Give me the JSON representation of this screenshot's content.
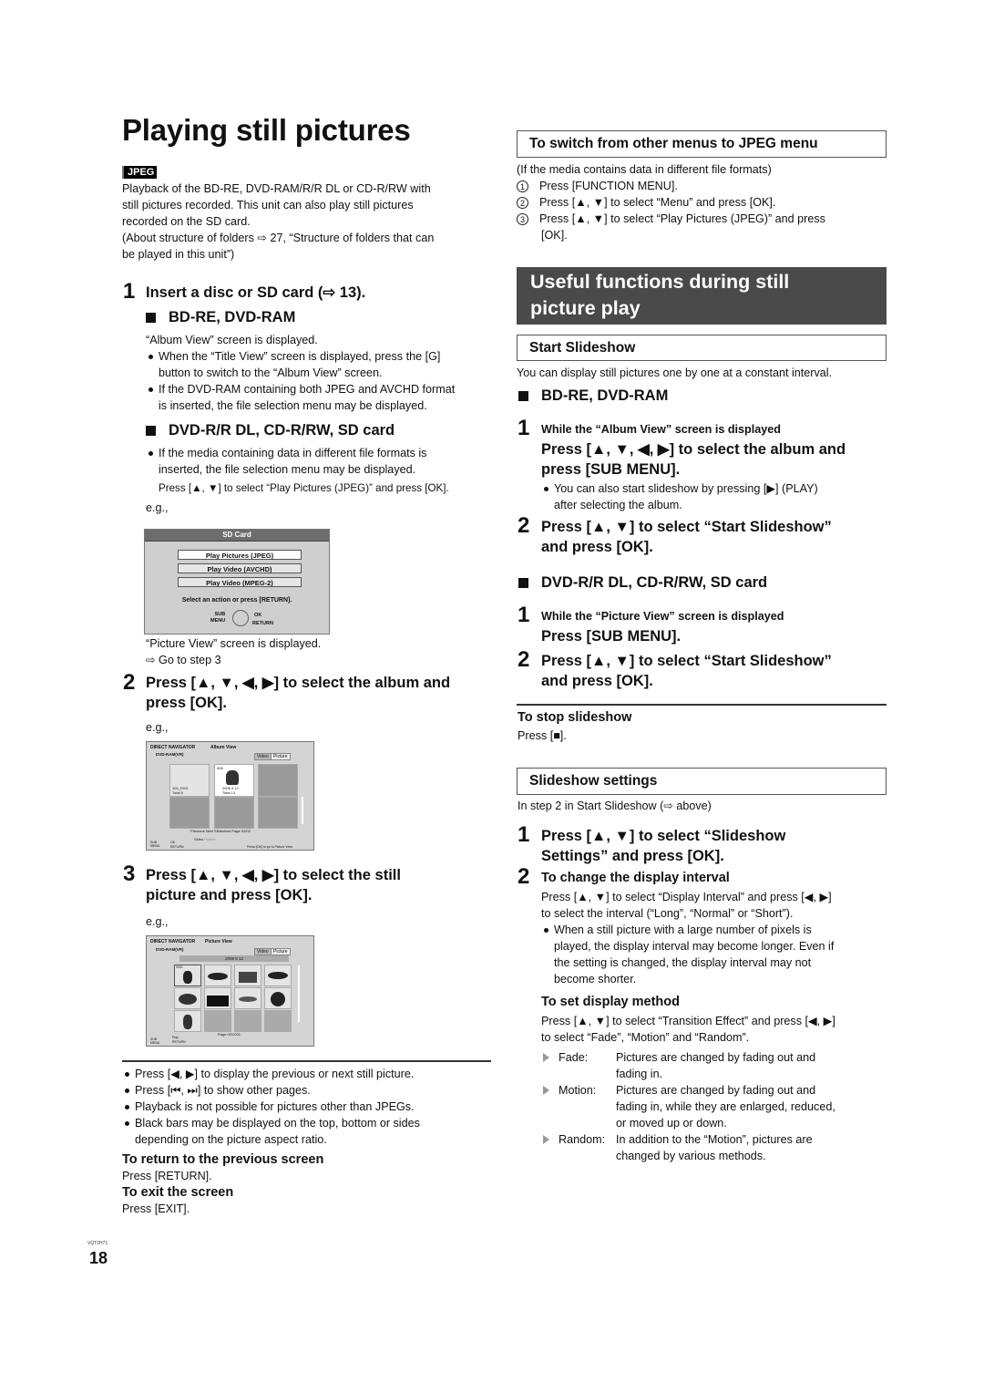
{
  "page": {
    "title": "Playing still pictures",
    "badge": "JPEG",
    "page_number": "18",
    "doc_code": "VQT2H71"
  },
  "intro": {
    "lines": [
      "Playback of the BD-RE, DVD-RAM/R/R DL or CD-R/RW with",
      "still pictures recorded. This unit can also play still pictures",
      "recorded on the SD card.",
      "(About structure of folders ⇨ 27, “Structure of folders that can",
      "be played in this unit”)"
    ]
  },
  "left_steps": {
    "step1": {
      "num": "1",
      "text": "Insert a disc or SD card (⇨ 13).",
      "bdre_head": "BD-RE, DVD-RAM",
      "bdre_note": "“Album View” screen is displayed.",
      "bdre_bullets": [
        [
          "When the “Title View” screen is displayed, press the [G]",
          "button to switch to the “Album View” screen."
        ],
        [
          "If the DVD-RAM containing both JPEG and AVCHD format",
          "is inserted, the file selection menu may be displayed."
        ]
      ],
      "dvdr_head": "DVD-R/R DL, CD-R/RW, SD card",
      "dvdr_bullet": [
        "If the media containing data in different file formats is",
        "inserted, the file selection menu may be displayed."
      ],
      "dvdr_press": "Press [▲, ▼] to select “Play Pictures (JPEG)” and press [OK].",
      "eg": "e.g.,",
      "after1": "“Picture View” screen is displayed.",
      "after2": "⇨ Go to step 3"
    },
    "step2": {
      "num": "2",
      "lines": [
        "Press [▲, ▼, ◀, ▶] to select the album and",
        "press [OK]."
      ],
      "eg": "e.g.,"
    },
    "step3": {
      "num": "3",
      "lines": [
        "Press [▲, ▼, ◀, ▶] to select the still",
        "picture and press [OK]."
      ],
      "eg": "e.g.,"
    }
  },
  "sd_menu": {
    "header": "SD Card",
    "options": [
      "Play Pictures (JPEG)",
      "Play Video (AVCHD)",
      "Play Video (MPEG-2)"
    ],
    "selected_index": 0,
    "prompt": "Select an action or press [RETURN].",
    "sub": "SUB",
    "menu": "MENU",
    "ok": "OK",
    "return": "RETURN"
  },
  "album_view": {
    "nav": "DIRECT NAVIGATOR",
    "view": "Album View",
    "drive": "DVD-RAM(VR)",
    "tabs": [
      "Video",
      "Picture"
    ],
    "albums": [
      {
        "name": "100_DVD",
        "total": "Total 8"
      },
      {
        "date": "2006 9 12",
        "total": "Total 13",
        "num": "008"
      }
    ],
    "controls": [
      "Previous",
      "Next",
      "Slideshow",
      "Page 02/02"
    ],
    "buttons": [
      "Video",
      "Picture"
    ],
    "footer_left_sub": "SUB",
    "footer_left_menu": "MENU",
    "ok": "OK",
    "return": "RETURN",
    "hint": "Press [OK] to go to Picture View"
  },
  "picture_view": {
    "nav": "DIRECT NAVIGATOR",
    "view": "Picture View",
    "drive": "DVD-RAM(VR)",
    "tabs": [
      "Video",
      "Picture"
    ],
    "date": "2006  9  12",
    "first_num": "0001",
    "page": "Page 001/001",
    "sub": "SUB",
    "menu": "MENU",
    "play": "Play",
    "return": "RETURN"
  },
  "left_notes": {
    "bullets": [
      "Press [◀, ▶] to display the previous or next still picture.",
      "Press [⏮, ⏭] to show other pages.",
      "Playback is not possible for pictures other than JPEGs.",
      "Black bars may be displayed on the top, bottom or sides"
    ],
    "bullet4_cont": "depending on the picture aspect ratio.",
    "return_head": "To return to the previous screen",
    "return_text": "Press [RETURN].",
    "exit_head": "To exit the screen",
    "exit_text": "Press [EXIT]."
  },
  "switch_menu": {
    "heading": "To switch from other menus to JPEG menu",
    "note": "(If the media contains data in different file formats)",
    "items": [
      {
        "mark": "1",
        "text": "Press [FUNCTION MENU]."
      },
      {
        "mark": "2",
        "text": "Press [▲, ▼] to select “Menu” and press [OK]."
      },
      {
        "mark": "3",
        "text": "Press [▲, ▼] to select “Play Pictures (JPEG)” and press"
      }
    ],
    "item3_cont": "[OK]."
  },
  "useful": {
    "banner_line1": "Useful functions during still",
    "banner_line2": "picture play"
  },
  "start_slideshow": {
    "heading": "Start Slideshow",
    "intro": "You can display still pictures one by one at a constant interval.",
    "bdre_head": "BD-RE, DVD-RAM",
    "bd_step1_num": "1",
    "bd_step1_cond": "While the “Album View” screen is displayed",
    "bd_step1_lines": [
      "Press [▲, ▼, ◀, ▶] to select the album and",
      "press [SUB MENU]."
    ],
    "bd_step1_bullet": [
      "You can also start slideshow by pressing [▶] (PLAY)",
      "after selecting the album."
    ],
    "bd_step2_num": "2",
    "bd_step2_lines": [
      "Press [▲, ▼] to select “Start Slideshow”",
      "and press [OK]."
    ],
    "dvdr_head": "DVD-R/R DL, CD-R/RW, SD card",
    "dv_step1_num": "1",
    "dv_step1_cond": "While the “Picture View” screen is displayed",
    "dv_step1_line": "Press [SUB MENU].",
    "dv_step2_num": "2",
    "dv_step2_lines": [
      "Press [▲, ▼] to select “Start Slideshow”",
      "and press [OK]."
    ],
    "stop_head": "To stop slideshow",
    "stop_text": "Press [■]."
  },
  "slideshow_settings": {
    "heading": "Slideshow settings",
    "intro": "In step 2 in Start Slideshow (⇨ above)",
    "step1_num": "1",
    "step1_lines": [
      "Press [▲, ▼] to select “Slideshow",
      "Settings” and press [OK]."
    ],
    "step2_num": "2",
    "interval_head": "To change the display interval",
    "interval_lines": [
      "Press [▲, ▼] to select “Display Interval” and press [◀, ▶]",
      "to select the interval (“Long”, “Normal” or “Short”)."
    ],
    "interval_bullet": [
      "When a still picture with a large number of pixels is",
      "played, the display interval may become longer. Even if",
      "the setting is changed, the display interval may not",
      "become shorter."
    ],
    "method_head": "To set display method",
    "method_lines": [
      "Press [▲, ▼] to select “Transition Effect” and press [◀, ▶]",
      "to select “Fade”, “Motion” and “Random”."
    ],
    "effects": [
      {
        "name": "Fade:",
        "lines": [
          "Pictures are changed by fading out and",
          "fading in."
        ]
      },
      {
        "name": "Motion:",
        "lines": [
          "Pictures are changed by fading out and",
          "fading in, while they are enlarged, reduced,",
          "or moved up or down."
        ]
      },
      {
        "name": "Random:",
        "lines": [
          "In addition to the “Motion”, pictures are",
          "changed by various methods."
        ]
      }
    ]
  }
}
